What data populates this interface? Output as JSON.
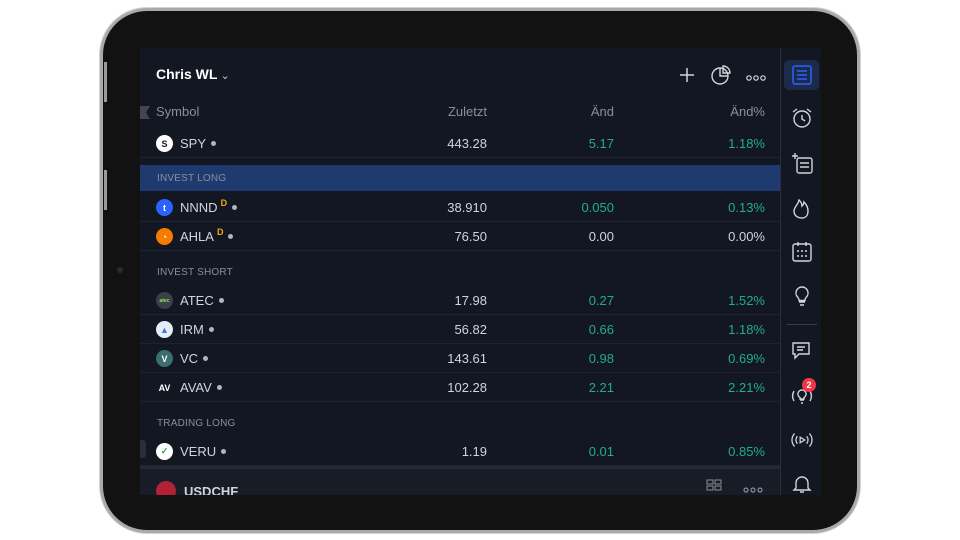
{
  "watchlist": {
    "title": "Chris WL",
    "title_chevron": "⌄",
    "columns": {
      "symbol": "Symbol",
      "last": "Zuletzt",
      "change": "Änd",
      "change_pct": "Änd%"
    },
    "sections": [
      {
        "label": "INVEST LONG",
        "selected": true
      },
      {
        "label": "INVEST SHORT",
        "selected": false
      },
      {
        "label": "TRADING LONG",
        "selected": false
      }
    ],
    "rows": [
      {
        "symbol": "SPY",
        "logo": "S",
        "last": "443.28",
        "change": "5.17",
        "change_pct": "1.18%",
        "badge": "",
        "logo_color": "#ffffff",
        "logo_text_color": "#131722",
        "change_color": "#22ab94"
      },
      {
        "symbol": "NNND",
        "logo": "t",
        "last": "38.910",
        "change": "0.050",
        "change_pct": "0.13%",
        "badge": "D",
        "logo_color": "#2962ff",
        "logo_text_color": "#ffffff",
        "change_color": "#22ab94"
      },
      {
        "symbol": "AHLA",
        "logo": "◔",
        "last": "76.50",
        "change": "0.00",
        "change_pct": "0.00%",
        "badge": "D",
        "logo_color": "#f57c00",
        "logo_text_color": "#ffffff",
        "change_color": "#d1d4dc"
      },
      {
        "symbol": "ATEC",
        "logo": "atec",
        "last": "17.98",
        "change": "0.27",
        "change_pct": "1.52%",
        "badge": "",
        "logo_color": "#3a3f4a",
        "logo_text_color": "#9be15d",
        "change_color": "#22ab94"
      },
      {
        "symbol": "IRM",
        "logo": "▲",
        "last": "56.82",
        "change": "0.66",
        "change_pct": "1.18%",
        "badge": "",
        "logo_color": "#e3ecf7",
        "logo_text_color": "#3a7bd5",
        "change_color": "#22ab94"
      },
      {
        "symbol": "VC",
        "logo": "V",
        "last": "143.61",
        "change": "0.98",
        "change_pct": "0.69%",
        "badge": "",
        "logo_color": "#3c6e71",
        "logo_text_color": "#ffffff",
        "change_color": "#22ab94"
      },
      {
        "symbol": "AVAV",
        "logo": "AV",
        "last": "102.28",
        "change": "2.21",
        "change_pct": "2.21%",
        "badge": "",
        "logo_color": "#131722",
        "logo_text_color": "#ffffff",
        "change_color": "#22ab94"
      },
      {
        "symbol": "VERU",
        "logo": "✓",
        "last": "1.19",
        "change": "0.01",
        "change_pct": "0.85%",
        "badge": "",
        "logo_color": "#ffffff",
        "logo_text_color": "#2e9d4b",
        "change_color": "#22ab94"
      }
    ],
    "bottom_symbol": "USDCHF"
  },
  "sidebar": {
    "items": [
      "watchlist-icon",
      "alarm-clock-icon",
      "add-list-icon",
      "hotlist-flame-icon",
      "calendar-icon",
      "lightbulb-icon",
      "chat-icon",
      "ideas-stream-icon",
      "live-stream-icon",
      "bell-icon"
    ],
    "notification_count": "2"
  },
  "colors": {
    "positive": "#22ab94",
    "background": "#131722",
    "selected_section": "#1e3a6e",
    "badge": "#f0a818",
    "notification": "#f23645"
  }
}
